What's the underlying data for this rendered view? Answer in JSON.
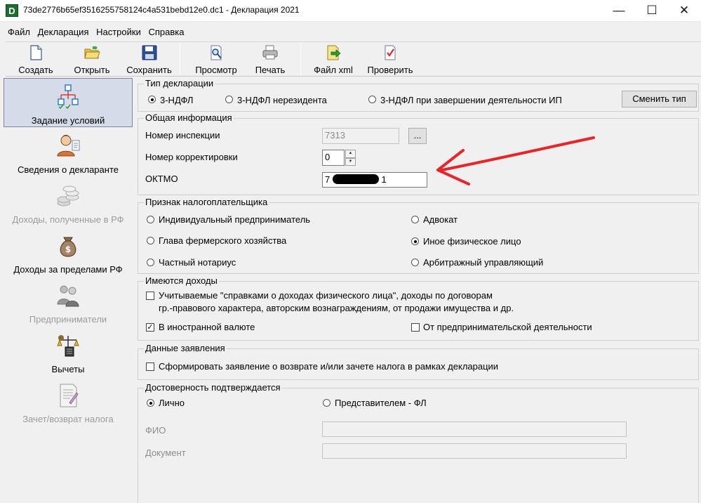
{
  "window": {
    "title": "73de2776b65ef3516255758124c4a531bebd12e0.dc1 - Декларация 2021",
    "app_icon": "D",
    "minimize": "—",
    "maximize": "☐",
    "close": "✕"
  },
  "menu": [
    "Файл",
    "Декларация",
    "Настройки",
    "Справка"
  ],
  "toolbar": {
    "create": "Создать",
    "open": "Открыть",
    "save": "Сохранить",
    "preview": "Просмотр",
    "print": "Печать",
    "xml": "Файл xml",
    "check": "Проверить"
  },
  "sidebar": {
    "items": [
      {
        "label": "Задание условий",
        "icon": "hierarchy-icon"
      },
      {
        "label": "Сведения о декларанте",
        "icon": "person-icon"
      },
      {
        "label": "Доходы, полученные в РФ",
        "icon": "coins-icon"
      },
      {
        "label": "Доходы за пределами РФ",
        "icon": "money-bag-icon"
      },
      {
        "label": "Предприниматели",
        "icon": "businessmen-icon"
      },
      {
        "label": "Вычеты",
        "icon": "scales-icon"
      },
      {
        "label": "Зачет/возврат налога",
        "icon": "document-icon"
      }
    ]
  },
  "declaration_type": {
    "title": "Тип декларации",
    "options": [
      "3-НДФЛ",
      "3-НДФЛ нерезидента",
      "3-НДФЛ при завершении деятельности ИП"
    ],
    "selected": "3-НДФЛ",
    "change_button": "Сменить тип"
  },
  "general_info": {
    "title": "Общая информация",
    "inspection_label": "Номер инспекции",
    "inspection_value": "7313",
    "browse_button": "...",
    "correction_label": "Номер корректировки",
    "correction_value": "0",
    "oktmo_label": "ОКТМО",
    "oktmo_value_start": "7",
    "oktmo_value_end": "1"
  },
  "taxpayer": {
    "title": "Признак налогоплательщика",
    "options": [
      "Индивидуальный предприниматель",
      "Адвокат",
      "Глава фермерского хозяйства",
      "Иное физическое лицо",
      "Частный нотариус",
      "Арбитражный управляющий"
    ],
    "selected": "Иное физическое лицо"
  },
  "income": {
    "title": "Имеются доходы",
    "certificates_line1": "Учитываемые \"справками о доходах физического лица\", доходы по договорам",
    "certificates_line2": "гр.-правового характера, авторским вознаграждениям, от продажи имущества и др.",
    "foreign_currency": "В иностранной валюте",
    "entrepreneurial": "От предпринимательской деятельности",
    "certificates_checked": false,
    "foreign_checked": true,
    "entrepreneurial_checked": false
  },
  "statement": {
    "title": "Данные заявления",
    "checkbox_label": "Сформировать заявление о  возврате и/или зачете налога в рамках декларации",
    "checked": false
  },
  "confirmation": {
    "title": "Достоверность подтверждается",
    "personally": "Лично",
    "representative": "Представителем - ФЛ",
    "selected": "Лично",
    "fio_label": "ФИО",
    "document_label": "Документ",
    "fio_value": "",
    "document_value": ""
  },
  "colors": {
    "annotation_arrow": "#e8262a",
    "redaction": "#000000",
    "active_nav": "#d6dbe9"
  }
}
